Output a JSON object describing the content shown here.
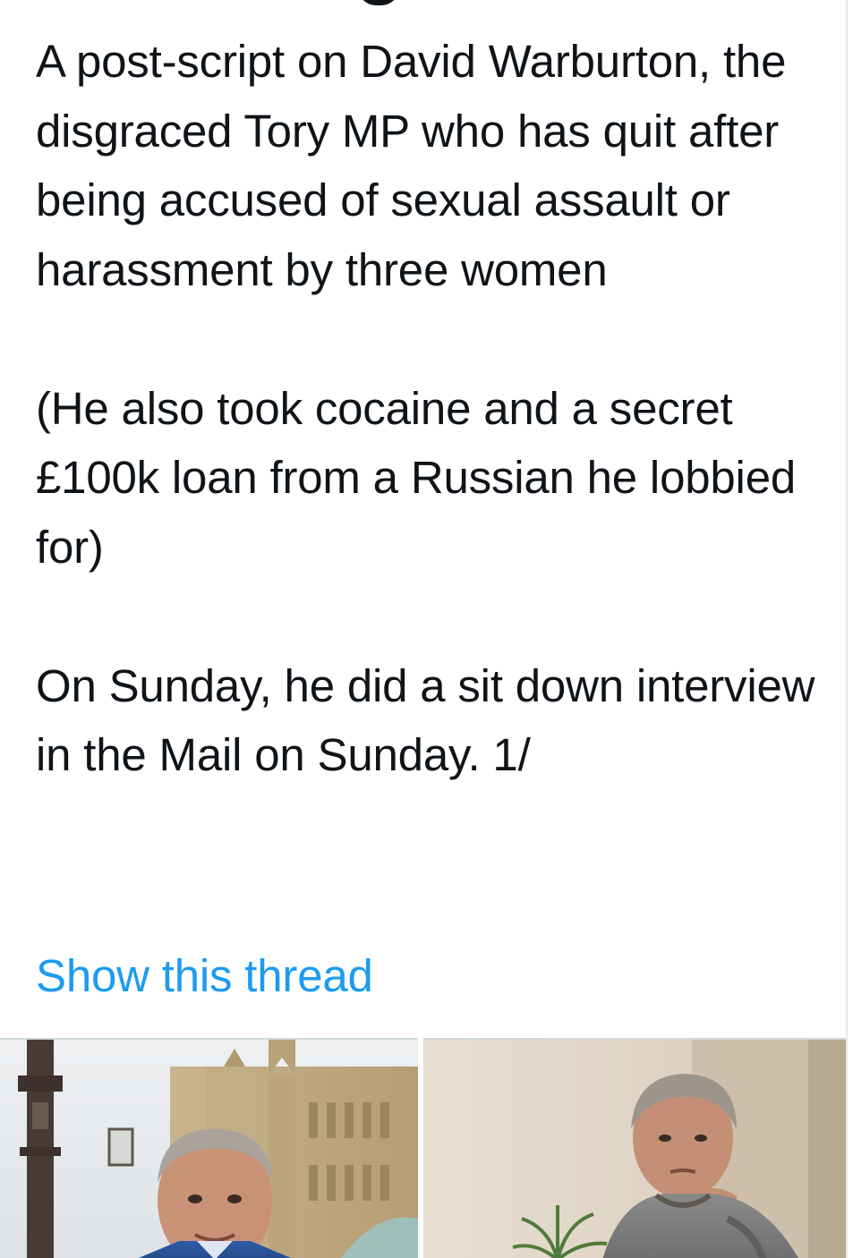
{
  "tweet": {
    "paragraphs": [
      "A post-script on David Warburton, the disgraced Tory MP who has quit after being accused of sexual assault or harassment by three women",
      "(He also took cocaine and a secret £100k loan from a Russian he lobbied for)",
      "On Sunday, he did a sit down interview in the Mail on Sunday. 1/"
    ],
    "show_thread_label": "Show this thread",
    "accent_color": "#1d9bf0",
    "text_color": "#0f1419"
  },
  "media": {
    "count": 2,
    "items": [
      {
        "kind": "photo",
        "subject": "man in suit outside parliament"
      },
      {
        "kind": "photo",
        "subject": "man resting chin on hand indoors"
      }
    ]
  }
}
